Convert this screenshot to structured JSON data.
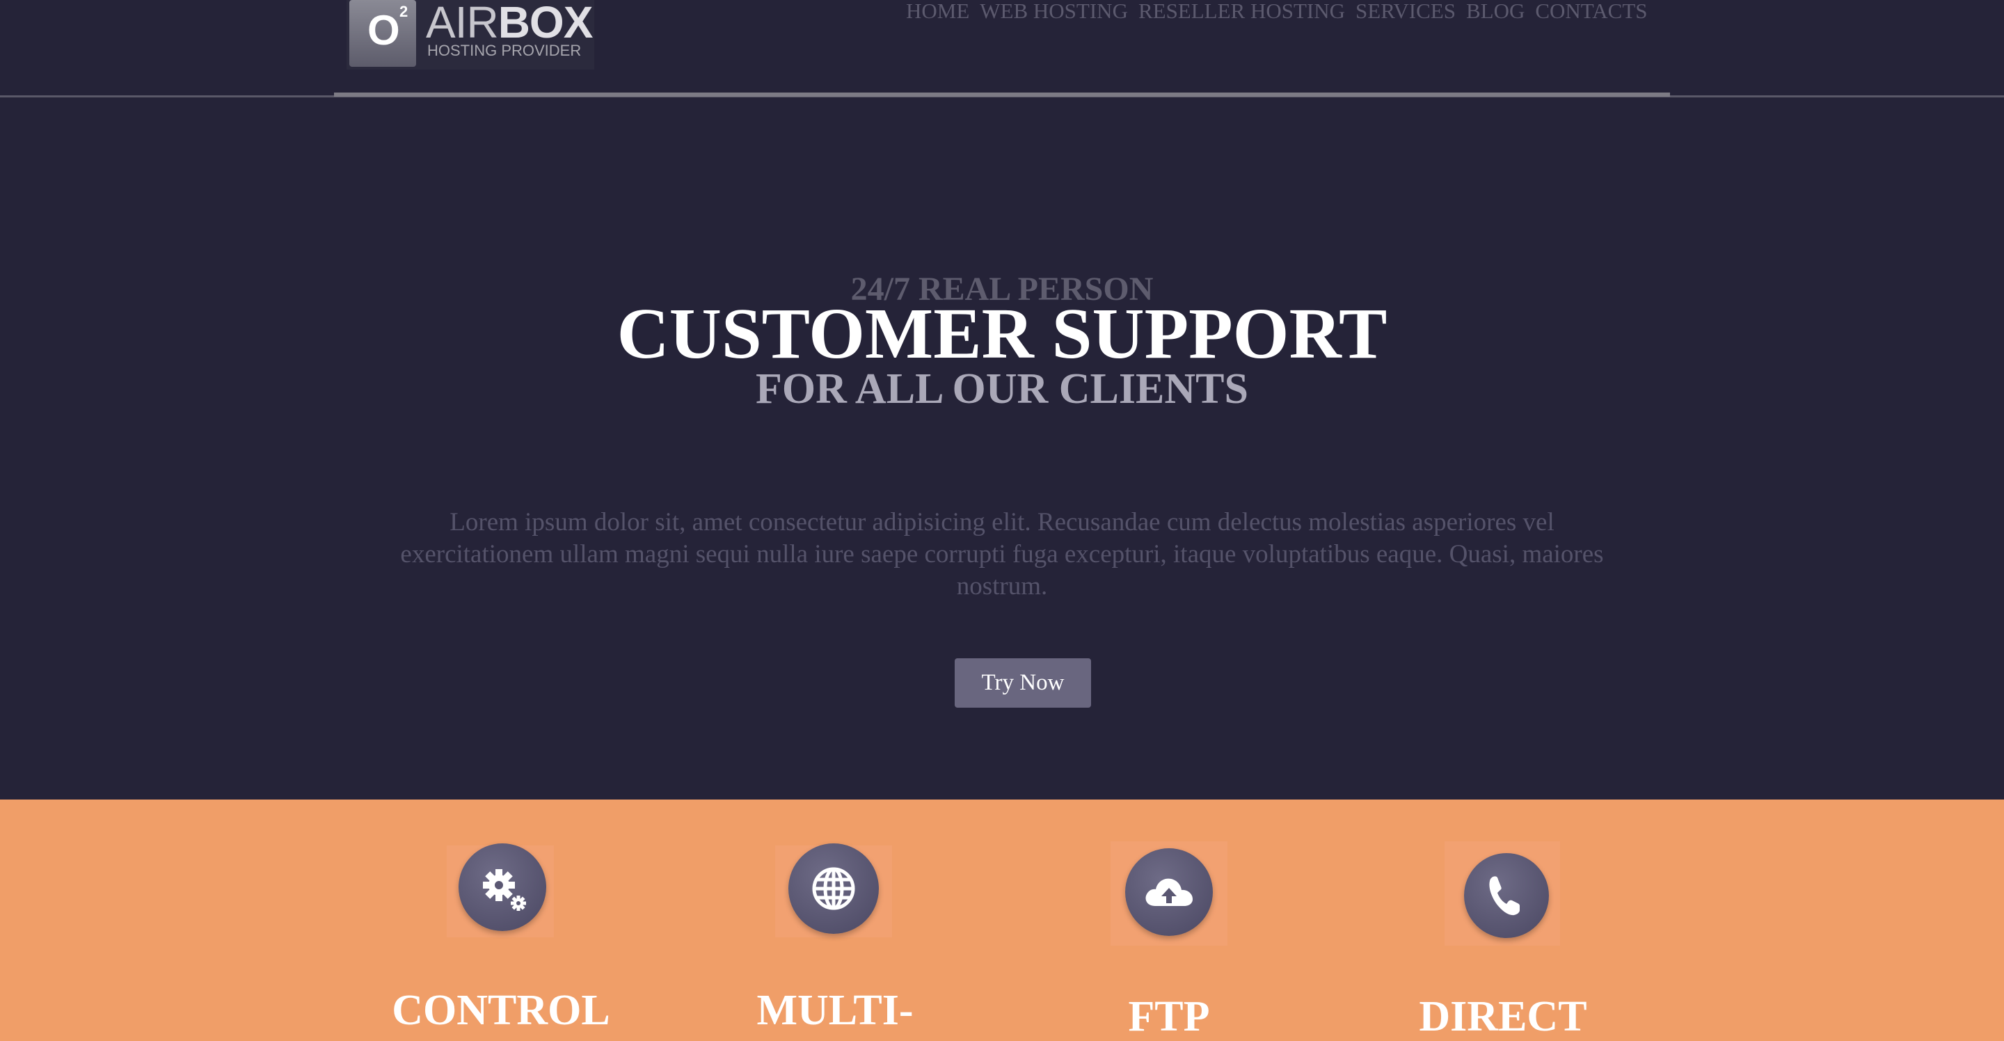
{
  "header": {
    "logo": {
      "badge": "O",
      "badge_sup": "2",
      "name_light": "AIR",
      "name_bold": "BOX",
      "tagline": "HOSTING PROVIDER"
    },
    "nav": [
      "HOME",
      "WEB HOSTING",
      "RESELLER HOSTING",
      "SERVICES",
      "BLOG",
      "CONTACTS"
    ]
  },
  "hero": {
    "pretitle": "24/7 REAL PERSON",
    "title": "CUSTOMER SUPPORT",
    "subtitle": "FOR ALL OUR CLIENTS",
    "text": "Lorem ipsum dolor sit, amet consectetur adipisicing elit. Recusandae cum delectus molestias asperiores vel exercitationem ullam magni sequi nulla iure saepe corrupti fuga excepturi, itaque voluptatibus eaque. Quasi, maiores nostrum.",
    "button": "Try Now"
  },
  "features": [
    {
      "icon": "gears-icon",
      "title": "CONTROL"
    },
    {
      "icon": "globe-icon",
      "title": "MULTI-"
    },
    {
      "icon": "cloud-upload-icon",
      "title": "FTP"
    },
    {
      "icon": "phone-icon",
      "title": "DIRECT"
    }
  ],
  "colors": {
    "background": "#252338",
    "accent": "#f09e68",
    "button": "#69667f",
    "icon_circle": "#5a5772"
  }
}
